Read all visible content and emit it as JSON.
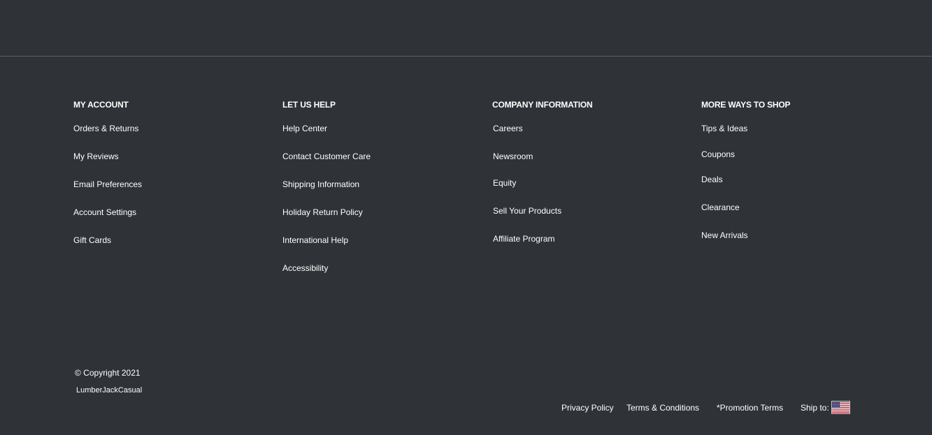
{
  "footer": {
    "columns": {
      "my_account": {
        "heading": "MY ACCOUNT",
        "links": [
          "Orders & Returns",
          "My Reviews",
          "Email Preferences",
          "Account Settings",
          "Gift Cards"
        ]
      },
      "let_us_help": {
        "heading": "LET US HELP",
        "links": [
          "Help Center",
          "Contact Customer Care",
          "Shipping Information",
          "Holiday Return Policy",
          "International Help",
          "Accessibility"
        ]
      },
      "company_information": {
        "heading": "COMPANY INFORMATION",
        "links": [
          "Careers",
          "Newsroom",
          "Equity",
          "Sell Your Products",
          "Affiliate Program"
        ]
      },
      "more_ways_to_shop": {
        "heading": "MORE WAYS TO SHOP",
        "links": [
          "Tips & Ideas",
          "Coupons",
          "Deals",
          "Clearance",
          "New Arrivals"
        ]
      }
    },
    "copyright": "© Copyright 2021",
    "brand": "LumberJackCasual",
    "bottom_links": {
      "privacy": "Privacy Policy",
      "terms": "Terms & Conditions",
      "promotion": "*Promotion Terms",
      "ship_to": "Ship to:"
    },
    "ship_to_flag_icon": "us-flag-icon",
    "colors": {
      "background": "#2f3237",
      "text": "#ffffff",
      "divider": "#5c5f63"
    }
  }
}
